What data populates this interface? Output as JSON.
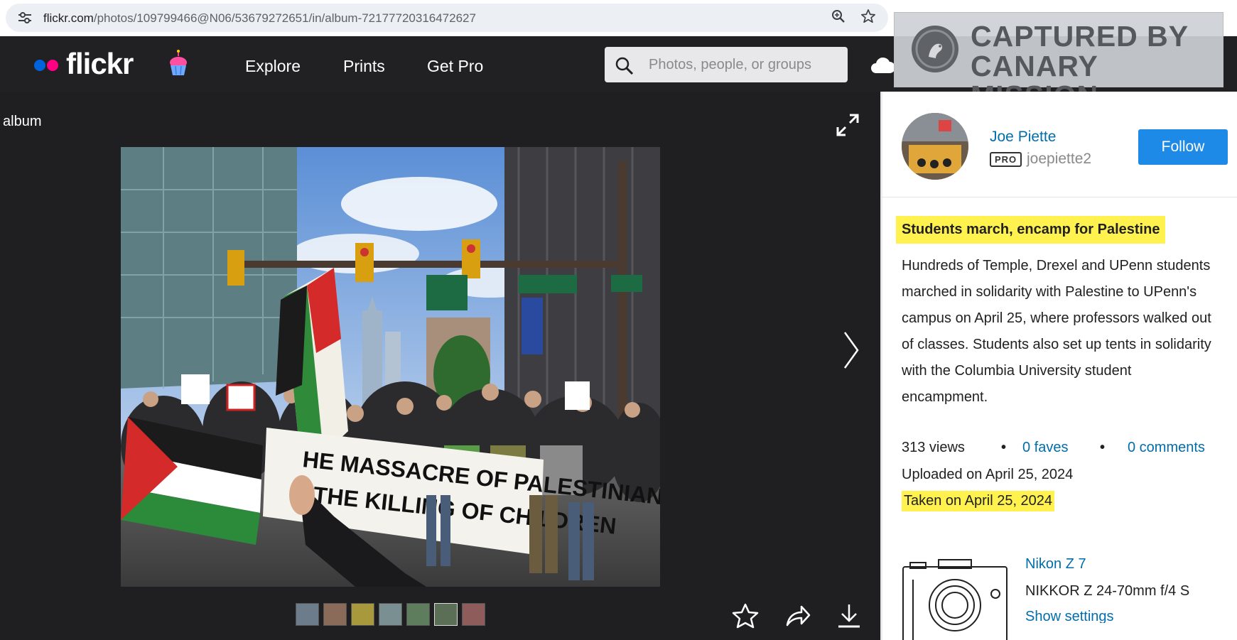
{
  "browser": {
    "url_host": "flickr.com",
    "url_path": "/photos/109799466@N06/53679272651/in/album-72177720316472627"
  },
  "nav": {
    "logo": "flickr",
    "links": [
      "Explore",
      "Prints",
      "Get Pro"
    ],
    "search_placeholder": "Photos, people, or groups",
    "logo_colors": {
      "blue": "#0063dc",
      "pink": "#ff0084"
    }
  },
  "overlay": {
    "watermark_line1": "CAPTURED BY",
    "watermark_line2": "CANARY MISSION"
  },
  "viewer": {
    "context_label": "album",
    "thumbnail_count": 7
  },
  "sidebar": {
    "owner_name": "Joe Piette",
    "pro_badge": "PRO",
    "username": "joepiette2",
    "follow_label": "Follow",
    "title": "Students march, encamp for Palestine",
    "description": "Hundreds of Temple, Drexel and UPenn students marched in solidarity with Palestine to UPenn's campus on April 25, where professors walked out of classes. Students also set up tents in solidarity with the Columbia University student encampment.",
    "views": "313 views",
    "faves": "0 faves",
    "comments": "0 comments",
    "uploaded": "Uploaded on April 25, 2024",
    "taken": "Taken on April 25, 2024",
    "camera": "Nikon Z 7",
    "lens": "NIKKOR Z 24-70mm f/4 S",
    "show_settings": "Show settings"
  },
  "colors": {
    "highlight": "#fff24f",
    "link": "#006dac",
    "follow": "#1c8ae6",
    "nav_bg": "#212124"
  },
  "icons": [
    "tune-icon",
    "zoom-icon",
    "bookmark-star-icon",
    "cupcake-icon",
    "search-icon",
    "cloud-upload-icon",
    "expand-icon",
    "chevron-right-icon",
    "fave-star-icon",
    "share-icon",
    "download-icon",
    "camera-icon"
  ]
}
